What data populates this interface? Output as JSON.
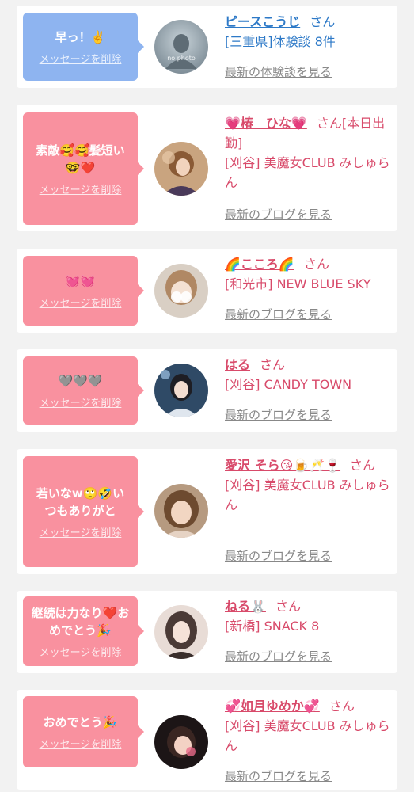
{
  "delete_label": "メッセージを削除",
  "suffix_san": "さん",
  "messages": [
    {
      "bubble": "早っ！✌️",
      "name": "ピースこうじ",
      "name_suffix": "",
      "shop": "[三重県]体験談 8件",
      "more": "最新の体験談を見る",
      "avatar_caption": "no photo",
      "theme": "blue"
    },
    {
      "bubble": "素敵🥰🥰髪短い\n🤓❤️",
      "name": "💗椿　ひな💗",
      "name_suffix": "[本日出勤]",
      "shop": "[刈谷] 美魔女CLUB みしゅらん",
      "more": "最新のブログを見る",
      "theme": "pink"
    },
    {
      "bubble": "💓💓",
      "name": "🌈こころ🌈",
      "name_suffix": "",
      "shop": "[和光市] NEW BLUE SKY",
      "more": "最新のブログを見る",
      "theme": "pink"
    },
    {
      "bubble": "🩶🩶🩶",
      "name": "はる",
      "name_suffix": "",
      "shop": "[刈谷] CANDY TOWN",
      "more": "最新のブログを見る",
      "theme": "pink"
    },
    {
      "bubble": "若いなw🙄🤣い\nつもありがと",
      "name": "愛沢 そら😘🍺🥂🍷",
      "name_suffix": "",
      "shop": "[刈谷] 美魔女CLUB みしゅらん",
      "more": "最新のブログを見る",
      "theme": "pink"
    },
    {
      "bubble": "継続は力なり❤️お\nめでとう🎉",
      "name": "ねる🐰",
      "name_suffix": "",
      "shop": "[新橋] SNACK 8",
      "more": "最新のブログを見る",
      "theme": "pink"
    },
    {
      "bubble": "おめでとう🎉",
      "name": "💞如月ゆめか💞",
      "name_suffix": "",
      "shop": "[刈谷] 美魔女CLUB みしゅらん",
      "more": "最新のブログを見る",
      "theme": "pink"
    }
  ],
  "colors": {
    "pink_bubble": "#f9919f",
    "blue_bubble": "#8eb4f0",
    "pink_text": "#d84a6a",
    "blue_text": "#2d79c7",
    "muted_link": "#888888"
  }
}
